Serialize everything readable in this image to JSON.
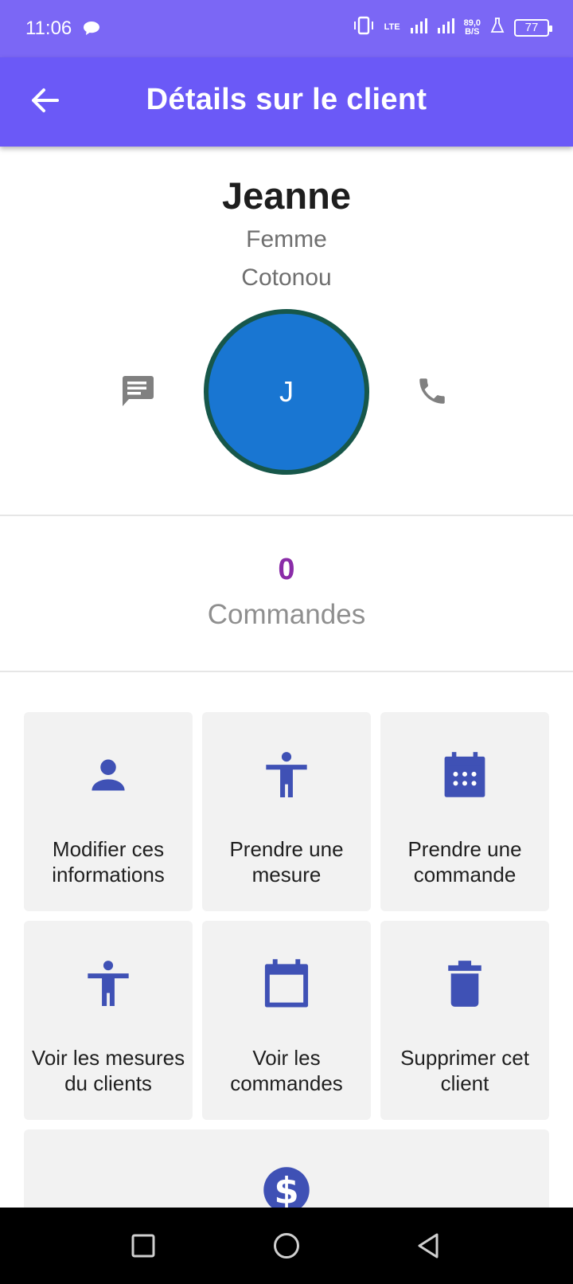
{
  "status_bar": {
    "time": "11:06",
    "lte": "LTE",
    "speed_value": "89,0",
    "speed_unit": "B/S",
    "battery": "77"
  },
  "app_bar": {
    "title": "Détails sur le client",
    "back_icon": "arrow-back-icon"
  },
  "client": {
    "name": "Jeanne",
    "gender": "Femme",
    "city": "Cotonou",
    "avatar_initial": "J",
    "avatar_color": "#1976d2",
    "avatar_border": "#17574a"
  },
  "orders": {
    "count": "0",
    "label": "Commandes",
    "count_color": "#8a2ca8"
  },
  "actions": [
    {
      "label": "Modifier ces informations",
      "icon": "person-icon"
    },
    {
      "label": "Prendre une mesure",
      "icon": "accessibility-icon"
    },
    {
      "label": "Prendre une commande",
      "icon": "calendar-grid-icon"
    },
    {
      "label": "Voir les mesures du clients",
      "icon": "accessibility-icon"
    },
    {
      "label": "Voir les commandes",
      "icon": "calendar-icon"
    },
    {
      "label": "Supprimer cet client",
      "icon": "trash-icon"
    },
    {
      "label": "",
      "icon": "dollar-icon"
    }
  ],
  "colors": {
    "status_bar": "#7b67f5",
    "app_bar": "#6b59f7",
    "action_icon": "#3f51b5",
    "tile_bg": "#f2f2f2"
  }
}
